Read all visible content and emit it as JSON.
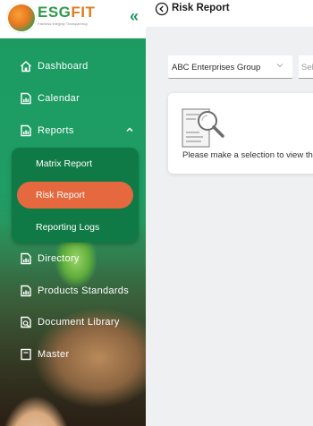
{
  "brand": {
    "logo_main": "ESG",
    "logo_accent": "FIT",
    "tagline": "Fairness Integrity Transparency"
  },
  "sidebar": {
    "collapse_glyph": "«",
    "items": [
      {
        "label": "Dashboard",
        "icon": "home-icon"
      },
      {
        "label": "Calendar",
        "icon": "calendar-icon"
      },
      {
        "label": "Reports",
        "icon": "report-icon",
        "expanded": true
      },
      {
        "label": "Directory",
        "icon": "directory-icon"
      },
      {
        "label": "Products Standards",
        "icon": "standards-icon"
      },
      {
        "label": "Document Library",
        "icon": "document-icon"
      },
      {
        "label": "Master",
        "icon": "master-icon"
      }
    ],
    "reports_submenu": [
      {
        "label": "Matrix Report",
        "active": false
      },
      {
        "label": "Risk Report",
        "active": true
      },
      {
        "label": "Reporting Logs",
        "active": false
      }
    ]
  },
  "header": {
    "title": "Risk Report"
  },
  "filters": {
    "company": {
      "value": "ABC Enterprises Group"
    },
    "second": {
      "placeholder": "Sel"
    }
  },
  "empty_state": {
    "message": "Please make a selection to view the"
  },
  "colors": {
    "sidebar_green": "#1a9a62",
    "active_orange": "#e5683f",
    "submenu_green": "#0f7a46"
  }
}
